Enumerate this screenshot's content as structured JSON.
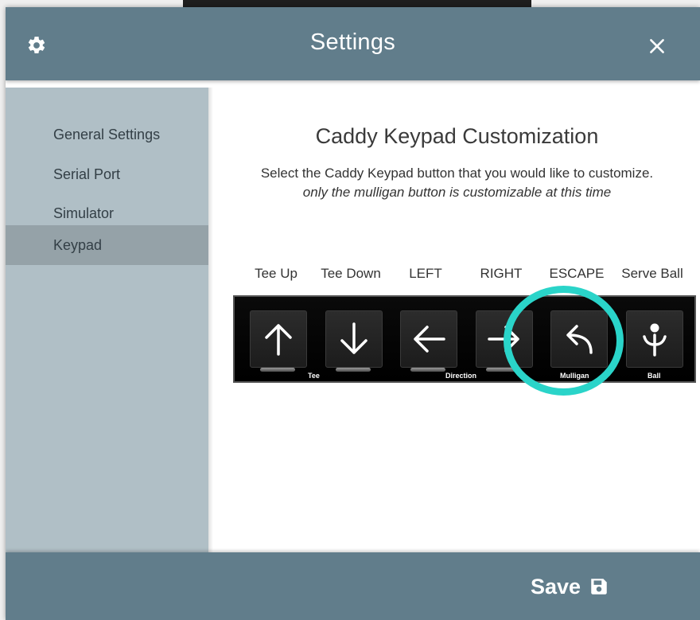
{
  "header": {
    "title": "Settings",
    "icons": {
      "left": "gear-icon",
      "right": "close-icon"
    }
  },
  "sidebar": {
    "items": [
      {
        "label": "General Settings",
        "active": false
      },
      {
        "label": "Serial Port",
        "active": false
      },
      {
        "label": "Simulator",
        "active": false
      },
      {
        "label": "Keypad",
        "active": true
      }
    ]
  },
  "main": {
    "heading": "Caddy Keypad Customization",
    "description": "Select the Caddy Keypad button that you would like to customize.",
    "note": "only the mulligan button is customizable at this time",
    "keys": [
      {
        "label": "Tee Up",
        "icon": "arrow-up-icon"
      },
      {
        "label": "Tee Down",
        "icon": "arrow-down-icon"
      },
      {
        "label": "LEFT",
        "icon": "arrow-left-icon"
      },
      {
        "label": "RIGHT",
        "icon": "arrow-right-icon"
      },
      {
        "label": "ESCAPE",
        "icon": "mulligan-icon"
      },
      {
        "label": "Serve Ball",
        "icon": "serve-ball-icon"
      }
    ],
    "keypad_texts": {
      "tee": "Tee",
      "direction": "Direction",
      "mulligan": "Mulligan",
      "ball": "Ball"
    },
    "highlighted_key": "ESCAPE"
  },
  "footer": {
    "save_label": "Save",
    "save_icon": "floppy-disk-icon"
  },
  "colors": {
    "header_bg": "#617d8b",
    "sidebar_bg": "#b0bfc6",
    "sidebar_active_bg": "#95a2a8",
    "highlight_ring": "#2ad4c9",
    "keypad_bg": "#000000"
  }
}
